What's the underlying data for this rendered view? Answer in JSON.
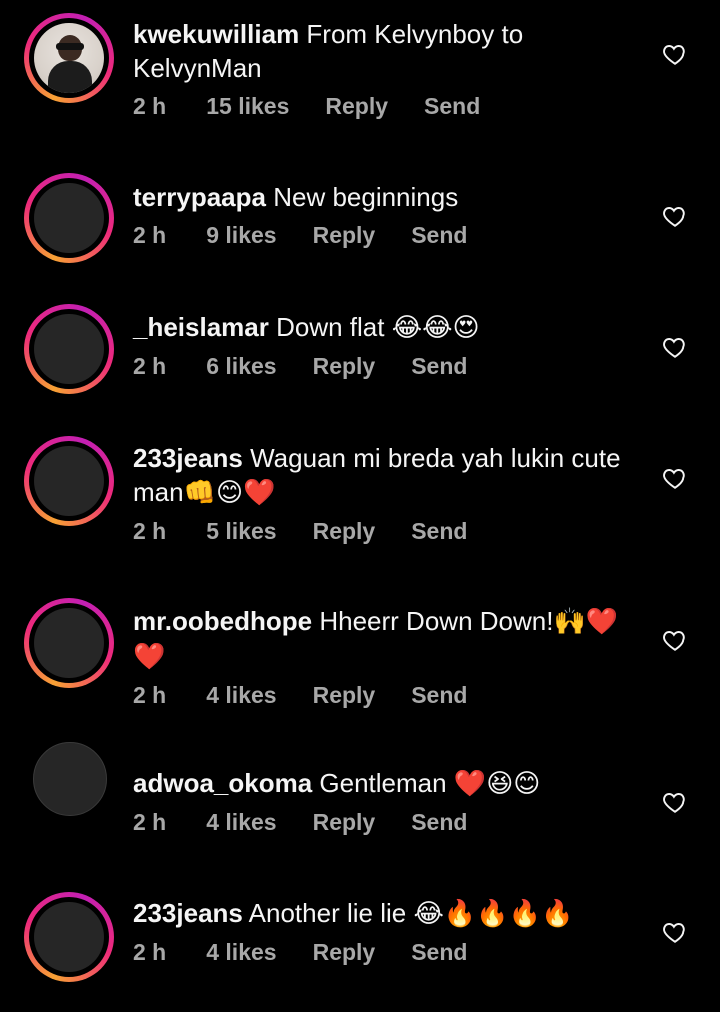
{
  "comments": [
    {
      "username": "kwekuwilliam",
      "text": "From Kelvynboy to KelvynMan",
      "emoji": "",
      "time": "2 h",
      "likes": "15 likes",
      "reply": "Reply",
      "send": "Send",
      "avatar": "photo-avatar",
      "story_ring": true
    },
    {
      "username": "terrypaapa",
      "text": "New beginnings",
      "emoji": "",
      "time": "2 h",
      "likes": "9 likes",
      "reply": "Reply",
      "send": "Send",
      "avatar": "blank-avatar",
      "story_ring": true
    },
    {
      "username": "_heislamar",
      "text": "Down flat",
      "emoji": "😂😂😍",
      "time": "2 h",
      "likes": "6 likes",
      "reply": "Reply",
      "send": "Send",
      "avatar": "blank-avatar",
      "story_ring": true
    },
    {
      "username": "233jeans",
      "text": "Waguan mi breda yah lukin cute man",
      "emoji": "👊😊❤️",
      "time": "2 h",
      "likes": "5 likes",
      "reply": "Reply",
      "send": "Send",
      "avatar": "blank-avatar",
      "story_ring": true
    },
    {
      "username": "mr.oobedhope",
      "text": "Hheerr Down Down!",
      "emoji": "🙌❤️❤️",
      "time": "2 h",
      "likes": "4 likes",
      "reply": "Reply",
      "send": "Send",
      "avatar": "blank-avatar",
      "story_ring": true
    },
    {
      "username": "adwoa_okoma",
      "text": "Gentleman",
      "emoji": "❤️😆😊",
      "time": "2 h",
      "likes": "4 likes",
      "reply": "Reply",
      "send": "Send",
      "avatar": "blank-avatar",
      "story_ring": false
    },
    {
      "username": "233jeans",
      "text": "Another lie lie",
      "emoji": "😂🔥🔥🔥🔥",
      "time": "2 h",
      "likes": "4 likes",
      "reply": "Reply",
      "send": "Send",
      "avatar": "blank-avatar",
      "story_ring": true
    }
  ],
  "icons": {
    "like": "heart-outline-icon"
  },
  "colors": {
    "background": "#000000",
    "text": "#f5f5f5",
    "meta_text": "#a8a8a8",
    "ring_start": "#f7a134",
    "ring_end": "#c21fb3"
  }
}
